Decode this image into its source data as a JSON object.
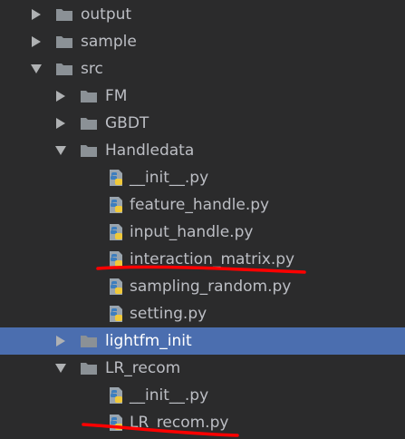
{
  "colors": {
    "background": "#2b2b2c",
    "text": "#bcbec4",
    "selected_row": "#4b6eaf",
    "folder_icon": "#8b9196",
    "annotation": "#ff0000"
  },
  "tree": {
    "items": [
      {
        "label": "output",
        "kind": "folder",
        "state": "collapsed",
        "depth": 1
      },
      {
        "label": "sample",
        "kind": "folder",
        "state": "collapsed",
        "depth": 1
      },
      {
        "label": "src",
        "kind": "folder",
        "state": "expanded",
        "depth": 1
      },
      {
        "label": "FM",
        "kind": "folder",
        "state": "collapsed",
        "depth": 2
      },
      {
        "label": "GBDT",
        "kind": "folder",
        "state": "collapsed",
        "depth": 2
      },
      {
        "label": "Handledata",
        "kind": "folder",
        "state": "expanded",
        "depth": 2
      },
      {
        "label": "__init__.py",
        "kind": "python-file",
        "depth": 3
      },
      {
        "label": "feature_handle.py",
        "kind": "python-file",
        "depth": 3
      },
      {
        "label": "input_handle.py",
        "kind": "python-file",
        "depth": 3
      },
      {
        "label": "interaction_matrix.py",
        "kind": "python-file",
        "depth": 3,
        "underlined": true
      },
      {
        "label": "sampling_random.py",
        "kind": "python-file",
        "depth": 3
      },
      {
        "label": "setting.py",
        "kind": "python-file",
        "depth": 3
      },
      {
        "label": "lightfm_init",
        "kind": "folder",
        "state": "collapsed",
        "depth": 2,
        "selected": true
      },
      {
        "label": "LR_recom",
        "kind": "folder",
        "state": "expanded",
        "depth": 2
      },
      {
        "label": "__init__.py",
        "kind": "python-file",
        "depth": 3
      },
      {
        "label": "LR_recom.py",
        "kind": "python-file",
        "depth": 3,
        "underlined": true
      }
    ]
  }
}
